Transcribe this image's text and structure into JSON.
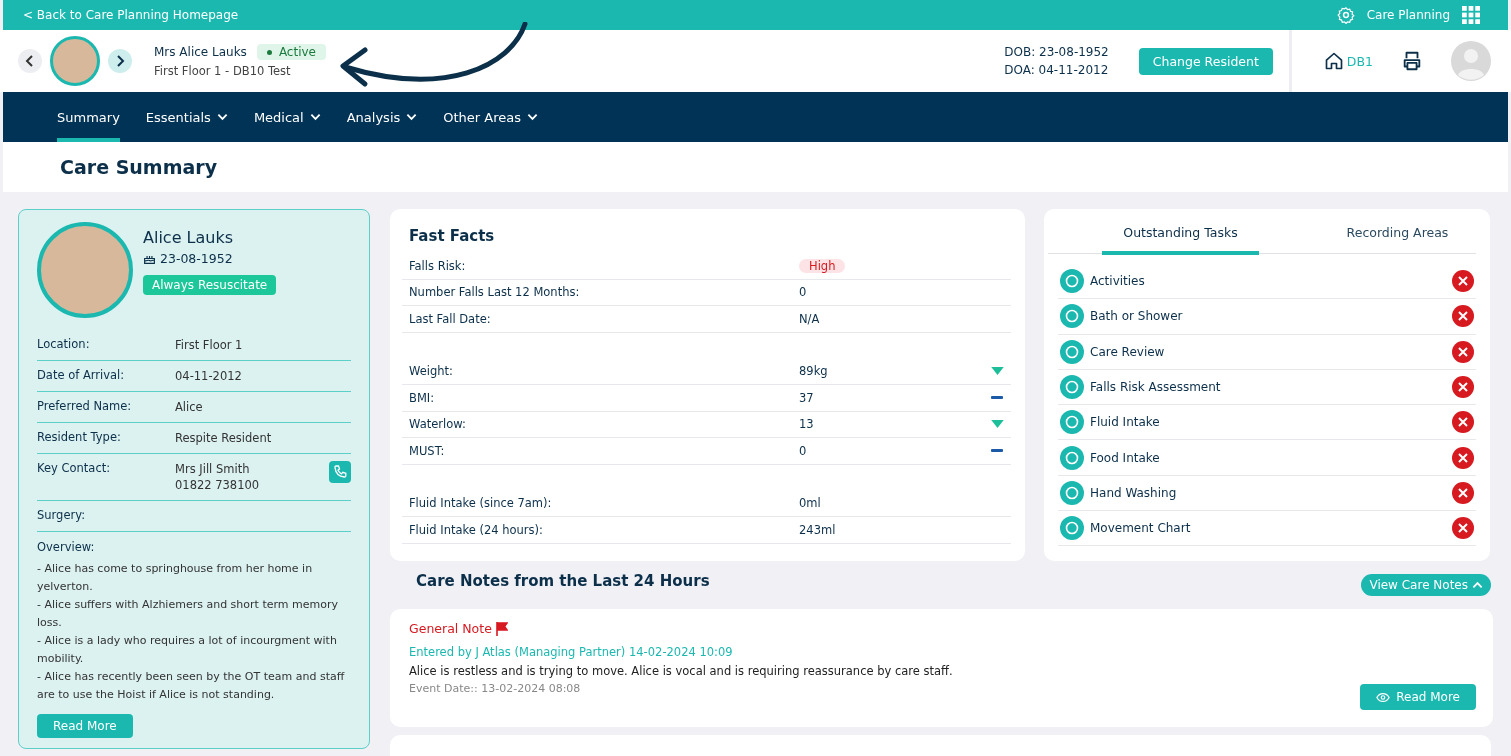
{
  "top_bar": {
    "back_link": "< Back to Care Planning Homepage",
    "app_name": "Care Planning"
  },
  "resident_header": {
    "name": "Mrs Alice Lauks",
    "status": "Active",
    "location": "First Floor 1 - DB10 Test",
    "dob": "DOB: 23-08-1952",
    "doa": "DOA: 04-11-2012",
    "change_button": "Change Resident",
    "home_code": "DB1"
  },
  "nav": [
    {
      "label": "Summary",
      "selected": true,
      "dropdown": false
    },
    {
      "label": "Essentials",
      "selected": false,
      "dropdown": true
    },
    {
      "label": "Medical",
      "selected": false,
      "dropdown": true
    },
    {
      "label": "Analysis",
      "selected": false,
      "dropdown": true
    },
    {
      "label": "Other Areas",
      "selected": false,
      "dropdown": true
    }
  ],
  "page_title": "Care Summary",
  "profile": {
    "name": "Alice Lauks",
    "birth_date": "23-08-1952",
    "resus_badge": "Always Resuscitate",
    "fields": [
      {
        "label": "Location:",
        "value": "First Floor 1"
      },
      {
        "label": "Date of Arrival:",
        "value": "04-11-2012"
      },
      {
        "label": "Preferred Name:",
        "value": "Alice"
      },
      {
        "label": "Resident Type:",
        "value": "Respite Resident"
      },
      {
        "label": "Key Contact:",
        "value": "Mrs Jill Smith",
        "value_2": "01822 738100",
        "phone": true
      },
      {
        "label": "Surgery:"
      }
    ],
    "overview_label": "Overview:",
    "overview": [
      "- Alice has come to springhouse from her home in yelverton.",
      "- Alice suffers with Alzhiemers and short term memory loss.",
      "- Alice is a lady who requires a lot of incourgment with mobility.",
      "- Alice has recently been seen by the OT team and staff are to use the Hoist if Alice is not standing."
    ],
    "read_more": "Read More"
  },
  "fast_facts": {
    "title": "Fast Facts",
    "groups": [
      [
        {
          "label": "Falls Risk:",
          "value": "High",
          "kind": "badge"
        },
        {
          "label": "Number Falls Last 12 Months:",
          "value": "0",
          "kind": "text"
        },
        {
          "label": "Last Fall Date:",
          "value": "N/A",
          "kind": "text"
        }
      ],
      [
        {
          "label": "Weight:",
          "value": "89kg",
          "kind": "text",
          "trend_down": true
        },
        {
          "label": "BMI:",
          "value": "37",
          "kind": "text",
          "trend_down": false
        },
        {
          "label": "Waterlow:",
          "value": "13",
          "kind": "text",
          "trend_down": true
        },
        {
          "label": "MUST:",
          "value": "0",
          "kind": "text",
          "trend_down": false
        }
      ],
      [
        {
          "label": "Fluid Intake (since 7am):",
          "value": "0ml",
          "kind": "text"
        },
        {
          "label": "Fluid Intake (24 hours):",
          "value": "243ml",
          "kind": "text"
        }
      ]
    ]
  },
  "tasks_panel": {
    "tabs": [
      {
        "label": "Outstanding Tasks",
        "selected": true
      },
      {
        "label": "Recording Areas",
        "selected": false
      }
    ],
    "tasks": [
      {
        "label": "Activities"
      },
      {
        "label": "Bath or Shower"
      },
      {
        "label": "Care Review"
      },
      {
        "label": "Falls Risk Assessment"
      },
      {
        "label": "Fluid Intake"
      },
      {
        "label": "Food Intake"
      },
      {
        "label": "Hand Washing"
      },
      {
        "label": "Movement Chart"
      }
    ]
  },
  "care_notes": {
    "title": "Care Notes from the Last 24 Hours",
    "view_button": "View Care Notes",
    "notes": [
      {
        "type": "General Note",
        "flagged": true,
        "entered_by": "Entered by J Atlas (Managing Partner) 14-02-2024 10:09",
        "text": "Alice is restless and is trying to move. Alice is vocal and is requiring reassurance by care staff.",
        "event_date": "Event Date:: 13-02-2024 08:08",
        "read_more": "Read More"
      }
    ]
  }
}
